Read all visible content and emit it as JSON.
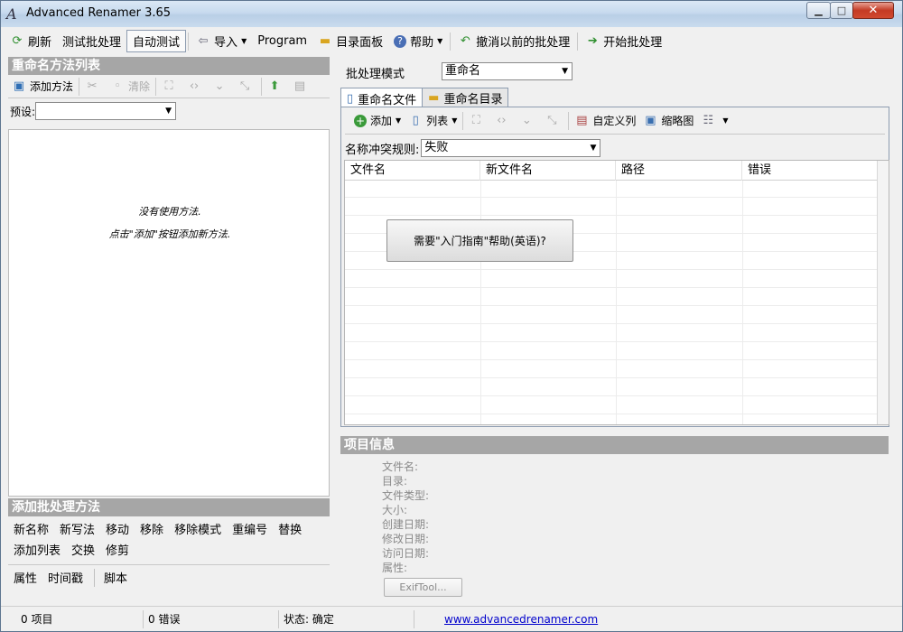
{
  "window": {
    "title": "Advanced Renamer 3.65",
    "min_glyph": "▁",
    "max_glyph": "□",
    "close_glyph": "✕"
  },
  "toolbar": {
    "refresh": "刷新",
    "test_batch": "测试批处理",
    "auto_test": "自动测试",
    "import": "导入",
    "program": "Program",
    "dir_panel": "目录面板",
    "help": "帮助",
    "undo_batch": "撤消以前的批处理",
    "start_batch": "开始批处理"
  },
  "left": {
    "method_list_title": "重命名方法列表",
    "add_method": "添加方法",
    "clear": "清除",
    "preset_label": "预设:",
    "preset_value": "",
    "empty_line1": "没有使用方法.",
    "empty_line2": "点击\"添加\"按钮添加新方法.",
    "add_batch_title": "添加批处理方法",
    "methods": [
      "新名称",
      "新写法",
      "移动",
      "移除",
      "移除模式",
      "重编号",
      "替换",
      "添加",
      "列表",
      "交换",
      "修剪"
    ],
    "methods2": [
      "属性",
      "时间戳",
      "脚本"
    ]
  },
  "right": {
    "batch_mode_label": "批处理模式",
    "batch_mode_value": "重命名",
    "tabs": [
      "重命名文件",
      "重命名目录"
    ],
    "add": "添加",
    "list": "列表",
    "custom_columns": "自定义列",
    "thumbnails": "缩略图",
    "conflict_label": "名称冲突规则:",
    "conflict_value": "失败",
    "columns": [
      "文件名",
      "新文件名",
      "路径",
      "错误"
    ],
    "help_prompt": "需要\"入门指南\"帮助(英语)?",
    "info_title": "项目信息",
    "info_fields": [
      "文件名:",
      "目录:",
      "文件类型:",
      "大小:",
      "创建日期:",
      "修改日期:",
      "访问日期:",
      "属性:"
    ],
    "exif_button": "ExifTool..."
  },
  "status": {
    "items": "0 项目",
    "errors": "0 错误",
    "state": "状态: 确定",
    "link": "www.advancedrenamer.com"
  }
}
